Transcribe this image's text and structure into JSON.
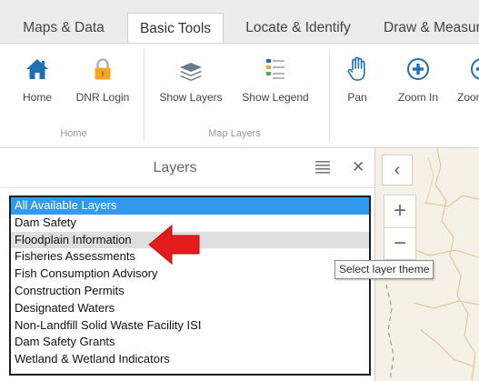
{
  "tabs": [
    {
      "label": "Maps & Data",
      "active": false
    },
    {
      "label": "Basic Tools",
      "active": true
    },
    {
      "label": "Locate & Identify",
      "active": false
    },
    {
      "label": "Draw & Measure",
      "active": false
    }
  ],
  "ribbon": {
    "buttons": [
      {
        "label": "Home",
        "icon": "house-icon"
      },
      {
        "label": "DNR Login",
        "icon": "lock-icon"
      },
      {
        "label": "Show Layers",
        "icon": "layers-icon"
      },
      {
        "label": "Show Legend",
        "icon": "legend-icon"
      },
      {
        "label": "Pan",
        "icon": "hand-icon"
      },
      {
        "label": "Zoom In",
        "icon": "zoom-in-icon"
      },
      {
        "label": "Zoom Out",
        "icon": "zoom-out-icon"
      }
    ],
    "groups": [
      {
        "label": "Home"
      },
      {
        "label": "Map Layers"
      }
    ]
  },
  "panel": {
    "title": "Layers",
    "close_symbol": "✕"
  },
  "layer_list": {
    "selected_index": 0,
    "hovered_index": 2,
    "options": [
      "All Available Layers",
      "Dam Safety",
      "Floodplain Information",
      "Fisheries Assessments",
      "Fish Consumption Advisory",
      "Construction Permits",
      "Designated Waters",
      "Non-Landfill Solid Waste Facility ISI",
      "Dam Safety Grants",
      "Wetland & Wetland Indicators"
    ]
  },
  "map_controls": {
    "collapse_symbol": "‹",
    "zoom_in_symbol": "+",
    "zoom_out_symbol": "−"
  },
  "tooltip": {
    "text": "Select layer theme"
  },
  "colors": {
    "accent": "#1f6fb5",
    "selected": "#3399ee",
    "hover_row": "#dedede",
    "icon_orange": "#f5a623",
    "arrow_red": "#e31b1b",
    "map_bg": "#f6f1e6"
  }
}
